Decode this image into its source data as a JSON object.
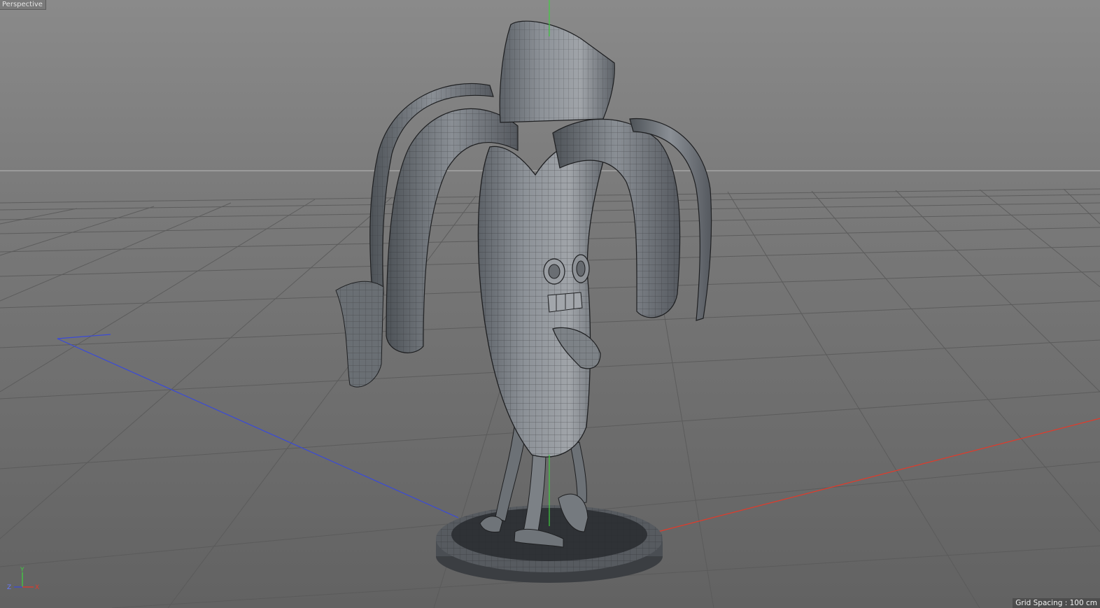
{
  "viewport": {
    "view_name": "Perspective",
    "grid_spacing_label": "Grid Spacing : 100 cm"
  },
  "axis_gizmo": {
    "y_label": "Y",
    "z_label": "Z",
    "x_label": "X"
  },
  "colors": {
    "x_axis": "#e23a2a",
    "y_axis": "#3fcf3f",
    "z_axis": "#3a4ad8",
    "model": "#7a7f85",
    "wire": "#1e1f21"
  },
  "scene": {
    "object": "banana character on round pedestal base",
    "icons": [
      "axis-gizmo-icon"
    ]
  }
}
